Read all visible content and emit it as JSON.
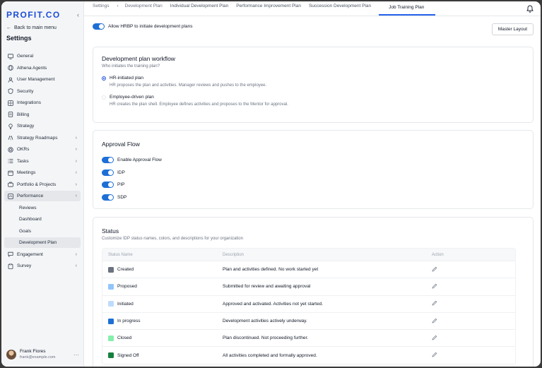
{
  "brand": {
    "logo": "PROFIT.CO",
    "accent": "#1d6fd6"
  },
  "sidebar": {
    "collapse_icon": "‹",
    "back_label": "Back to main menu",
    "title": "Settings",
    "items": [
      {
        "label": "General",
        "icon": "monitor-icon"
      },
      {
        "label": "Athena Agents",
        "icon": "globe-icon"
      },
      {
        "label": "User Management",
        "icon": "user-icon"
      },
      {
        "label": "Security",
        "icon": "shield-icon"
      },
      {
        "label": "Integrations",
        "icon": "grid-icon"
      },
      {
        "label": "Billing",
        "icon": "receipt-icon"
      },
      {
        "label": "Strategy",
        "icon": "bulb-icon"
      },
      {
        "label": "Strategy Roadmaps",
        "icon": "roadmap-icon"
      },
      {
        "label": "OKRs",
        "icon": "target-icon"
      },
      {
        "label": "Tasks",
        "icon": "list-icon"
      },
      {
        "label": "Meetings",
        "icon": "calendar-icon"
      },
      {
        "label": "Portfolio & Projects",
        "icon": "briefcase-icon"
      },
      {
        "label": "Performance",
        "icon": "gauge-icon"
      }
    ],
    "sub_items": [
      "Reviews",
      "Dashboard",
      "Goals",
      "Development Plan"
    ],
    "after_items": [
      {
        "label": "Engagement",
        "icon": "chat-icon"
      },
      {
        "label": "Survey",
        "icon": "clipboard-icon"
      }
    ],
    "user": {
      "name": "Frank Flores",
      "email": "frank@example.com"
    }
  },
  "topbar": {
    "crumbs": [
      "Settings",
      "Development Plan"
    ],
    "tabs": [
      "Individual Development Plan",
      "Performance Improvement Plan",
      "Succession Development Plan",
      "Job Training Plan"
    ],
    "active_tab": "Job Training Plan"
  },
  "hrbp_toggle": {
    "label": "Allow HRBP to initiate development plans",
    "on": true
  },
  "master_layout_label": "Master Layout",
  "workflow": {
    "title": "Development plan workflow",
    "subtitle": "Who initiates the training plan?",
    "options": [
      {
        "label": "HR-initiated plan",
        "desc": "HR proposes the plan and activities. Manager reviews and pushes to the employee.",
        "selected": true
      },
      {
        "label": "Employee-driven plan",
        "desc": "HR creates the plan shell. Employee defines activities and proposes to the Mentor for approval.",
        "selected": false
      }
    ]
  },
  "approval": {
    "title": "Approval Flow",
    "toggles": [
      {
        "label": "Enable Approval Flow",
        "on": true
      },
      {
        "label": "IDP",
        "on": true
      },
      {
        "label": "PIP",
        "on": true
      },
      {
        "label": "SDP",
        "on": true
      }
    ]
  },
  "status": {
    "title": "Status",
    "subtitle": "Customize IDP status names, colors, and descriptions for your organization",
    "columns": [
      "Status Name",
      "Description",
      "Action"
    ],
    "rows": [
      {
        "name": "Created",
        "color": "#6b7280",
        "desc": "Plan and activities defined. No work started yet"
      },
      {
        "name": "Proposed",
        "color": "#93c5fd",
        "desc": "Submitted for review and awaiting approval"
      },
      {
        "name": "Initiated",
        "color": "#bfdbfe",
        "desc": "Approved and activated. Activities not yet started."
      },
      {
        "name": "In progress",
        "color": "#1d6fd6",
        "desc": "Development activities actively underway."
      },
      {
        "name": "Closed",
        "color": "#86efac",
        "desc": "Plan discontinued. Not proceeding further."
      },
      {
        "name": "Signed Off",
        "color": "#15803d",
        "desc": "All activities completed and formally approved."
      }
    ]
  }
}
